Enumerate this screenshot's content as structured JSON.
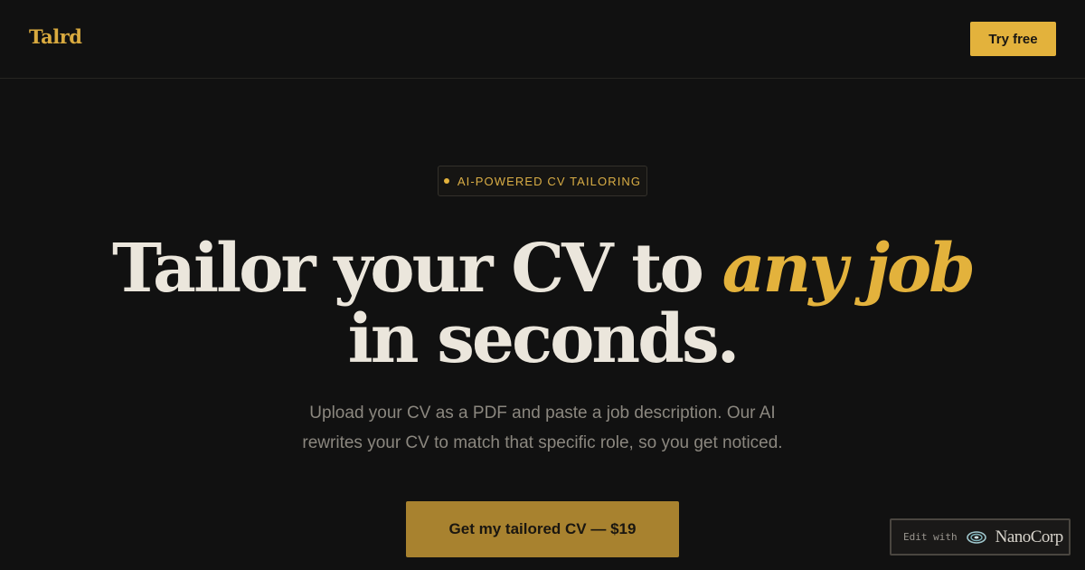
{
  "header": {
    "logo": "Talrd",
    "try_label": "Try free"
  },
  "hero": {
    "badge": "AI-POWERED CV TAILORING",
    "headline_part1": "Tailor your CV to ",
    "headline_accent": "any job",
    "headline_part2": "in seconds.",
    "subtitle_line1": "Upload your CV as a PDF and paste a job description. Our AI",
    "subtitle_line2": "rewrites your CV to match that specific role, so you get noticed.",
    "cta_label": "Get my tailored CV — $19"
  },
  "nanocorp": {
    "edit_label": "Edit with",
    "brand": "NanoCorp",
    "icon": "nanocorp-logo-icon"
  },
  "colors": {
    "background": "#111111",
    "accent": "#e3b23c",
    "cta": "#a8822f",
    "headline": "#ebe6dc",
    "subtitle": "#8b877f"
  }
}
